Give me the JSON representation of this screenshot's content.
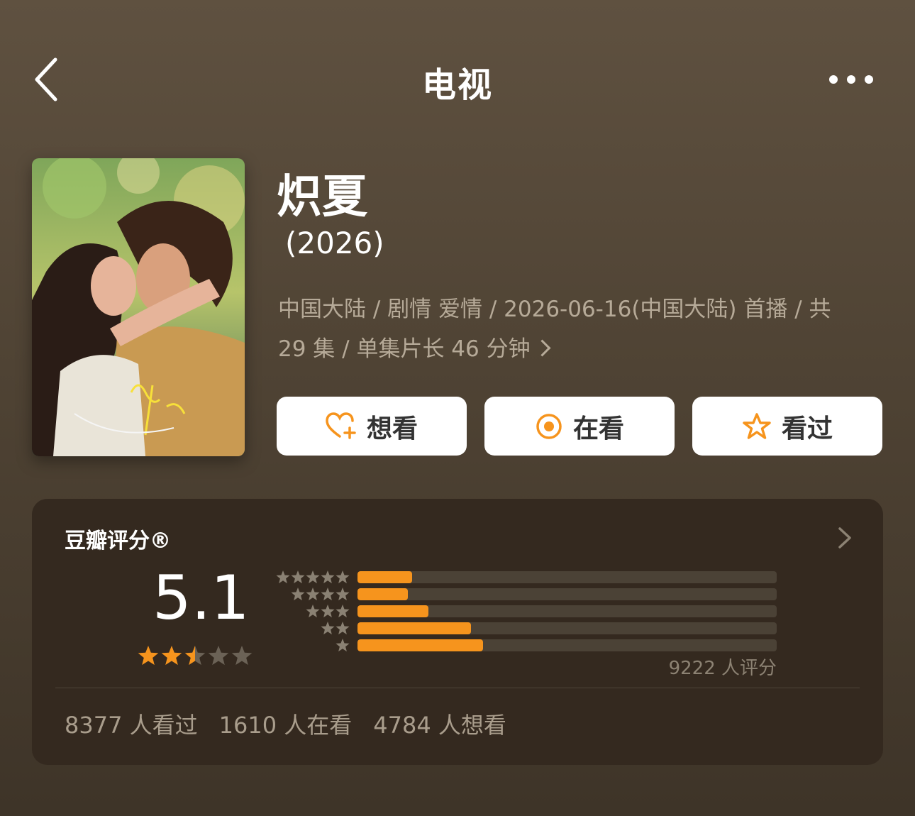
{
  "nav": {
    "title": "电视"
  },
  "show": {
    "title": "炽夏",
    "year": "(2026)",
    "meta_line1": "中国大陆 / 剧情 爱情 / 2026-06-16(中国大陆) 首播 / 共",
    "meta_line2": "29 集 / 单集片长 46 分钟"
  },
  "actions": [
    {
      "label": "想看",
      "icon": "heart-plus-icon"
    },
    {
      "label": "在看",
      "icon": "radio-dot-icon"
    },
    {
      "label": "看过",
      "icon": "star-outline-icon"
    }
  ],
  "rating": {
    "heading": "豆瓣评分®",
    "score": "5.1",
    "stars_value": 2.5,
    "distribution": [
      {
        "stars": 5,
        "fraction": 0.13
      },
      {
        "stars": 4,
        "fraction": 0.12
      },
      {
        "stars": 3,
        "fraction": 0.17
      },
      {
        "stars": 2,
        "fraction": 0.27
      },
      {
        "stars": 1,
        "fraction": 0.3
      }
    ],
    "total": "9222 人评分",
    "stats": [
      "8377 人看过",
      "1610 人在看",
      "4784 人想看"
    ]
  },
  "colors": {
    "accent": "#f6941d",
    "card": "#34291f",
    "background": "#55493a"
  }
}
